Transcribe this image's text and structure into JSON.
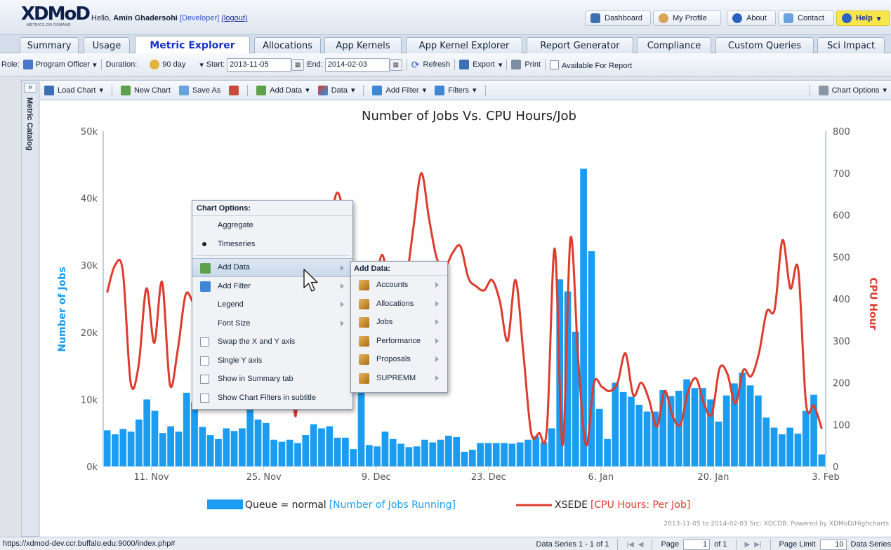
{
  "header": {
    "logo_text": "XDMoD",
    "logo_subtitle": "METRICS ON DEMAND",
    "greeting": "Hello,",
    "user_name": "Amin Ghadersohi",
    "user_role": "[Developer]",
    "logout": "(logout)",
    "buttons": {
      "dashboard": "Dashboard",
      "my_profile": "My Profile",
      "about": "About",
      "contact": "Contact",
      "help": "Help"
    }
  },
  "tabs": [
    "Summary",
    "Usage",
    "Metric Explorer",
    "Allocations",
    "App Kernels",
    "App Kernel Explorer",
    "Report Generator",
    "Compliance",
    "Custom Queries",
    "Sci Impact"
  ],
  "active_tab": "Metric Explorer",
  "rolebar": {
    "role_label": "Role:",
    "role_value": "Program Officer",
    "duration_label": "Duration:",
    "duration_value": "90 day",
    "start_label": "Start:",
    "start_value": "2013-11-05",
    "end_label": "End:",
    "end_value": "2014-02-03",
    "refresh": "Refresh",
    "export": "Export",
    "print": "Print",
    "available_for_report": "Available For Report"
  },
  "catalog": {
    "label": "Metric Catalog",
    "expand": "»"
  },
  "chart_toolbar": {
    "load_chart": "Load Chart",
    "new_chart": "New Chart",
    "save_as": "Save As",
    "add_data": "Add Data",
    "data": "Data",
    "add_filter": "Add Filter",
    "filters": "Filters",
    "chart_options": "Chart Options"
  },
  "chart_options_menu": {
    "title": "Chart Options:",
    "items": {
      "aggregate": "Aggregate",
      "timeseries": "Timeseries",
      "add_data": "Add Data",
      "add_filter": "Add Filter",
      "legend": "Legend",
      "font_size": "Font Size",
      "swap_axes": "Swap the X and Y axis",
      "single_y": "Single Y axis",
      "show_summary": "Show in Summary tab",
      "show_filters": "Show Chart Filters in subtitle"
    }
  },
  "add_data_menu": {
    "title": "Add Data:",
    "items": [
      "Accounts",
      "Allocations",
      "Jobs",
      "Performance",
      "Proposals",
      "SUPREMM"
    ]
  },
  "chart_data": {
    "type": "bar",
    "title": "Number of Jobs Vs. CPU Hours/Job",
    "ylabel": "Number of Jobs",
    "y2label": "CPU Hour",
    "ylim": [
      0,
      50000
    ],
    "y2lim": [
      0,
      800
    ],
    "yticks": [
      "0k",
      "10k",
      "20k",
      "30k",
      "40k",
      "50k"
    ],
    "y2ticks": [
      "0",
      "100",
      "200",
      "300",
      "400",
      "500",
      "600",
      "700",
      "800"
    ],
    "xticks": [
      "11. Nov",
      "25. Nov",
      "9. Dec",
      "23. Dec",
      "6. Jan",
      "20. Jan",
      "3. Feb"
    ],
    "x_start": "2013-11-05",
    "x_end": "2014-02-03",
    "series": [
      {
        "name": "Queue = normal",
        "metric": "[Number of Jobs Running]",
        "type": "bar",
        "color": "#1a9cf0",
        "values": [
          5400,
          4800,
          5600,
          5200,
          7000,
          10000,
          8300,
          5000,
          6000,
          5200,
          11000,
          9600,
          5900,
          4700,
          4100,
          5700,
          5300,
          5700,
          8800,
          7000,
          6500,
          4000,
          3700,
          4000,
          3500,
          4700,
          6300,
          5700,
          6000,
          4300,
          4300,
          2600,
          29000,
          3200,
          3000,
          5200,
          4100,
          3400,
          2900,
          3000,
          4000,
          3600,
          4000,
          4600,
          4400,
          2200,
          2500,
          3500,
          3500,
          3500,
          3500,
          3400,
          3600,
          4000,
          4500,
          3600,
          5700,
          27900,
          26100,
          20100,
          44400,
          32100,
          8600,
          4100,
          12500,
          11100,
          10400,
          9200,
          8200,
          8200,
          11400,
          10500,
          11300,
          13000,
          11700,
          11700,
          10000,
          6700,
          10600,
          12400,
          14000,
          12100,
          10600,
          7300,
          5800,
          4800,
          5800,
          4900,
          8300,
          10700,
          1800
        ]
      },
      {
        "name": "XSEDE",
        "metric": "[CPU Hours: Per Job]",
        "type": "line",
        "color": "#dd3b2d",
        "values": [
          415,
          480,
          465,
          200,
          240,
          425,
          295,
          440,
          195,
          280,
          410,
          390,
          380,
          360,
          340,
          355,
          330,
          325,
          310,
          330,
          340,
          430,
          475,
          470,
          120,
          525,
          425,
          195,
          440,
          640,
          610,
          410,
          400,
          430,
          420,
          505,
          425,
          440,
          440,
          570,
          700,
          590,
          495,
          475,
          510,
          525,
          450,
          430,
          420,
          445,
          395,
          300,
          445,
          270,
          80,
          80,
          90,
          520,
          50,
          545,
          250,
          50,
          200,
          190,
          180,
          200,
          270,
          170,
          200,
          160,
          95,
          180,
          120,
          100,
          180,
          210,
          150,
          125,
          235,
          220,
          150,
          230,
          215,
          270,
          370,
          375,
          540,
          425,
          470,
          150,
          145,
          90
        ]
      }
    ],
    "legend_position": "bottom",
    "credits": "2013-11-05 to 2014-02-03 Src: XDCDB. Powered by XDMoD/Highcharts"
  },
  "statusbar": {
    "url": "https://xdmod-dev.ccr.buffalo.edu:9000/index.php#",
    "data_series": "Data Series 1 - 1 of 1",
    "page_label": "Page",
    "page_value": "1",
    "of_pages": "of 1",
    "page_limit_label": "Page Limit",
    "page_limit_value": "10",
    "data_series_label": "Data Series"
  }
}
